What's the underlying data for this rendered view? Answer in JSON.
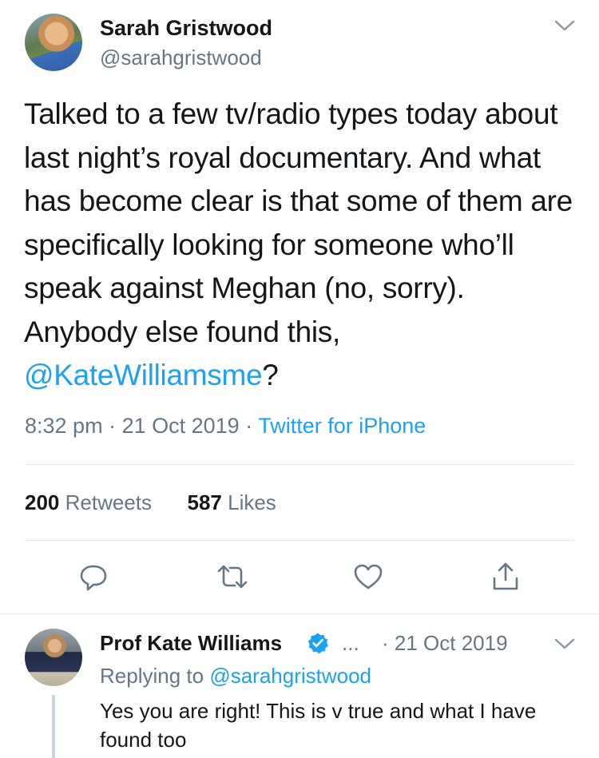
{
  "tweet": {
    "author_name": "Sarah Gristwood",
    "author_handle": "@sarahgristwood",
    "text_before_mention": "Talked to a few tv/radio types today about last night’s royal documentary. And what has become clear is that some of them are specifically looking for someone who’ll speak against Meghan (no, sorry). Anybody else found this, ",
    "mention": "@KateWilliamsme",
    "text_after_mention": "?",
    "time": "8:32 pm",
    "separator": "·",
    "date": "21 Oct 2019",
    "source": "Twitter for iPhone",
    "retweets_count": "200",
    "retweets_label": "Retweets",
    "likes_count": "587",
    "likes_label": "Likes"
  },
  "actions": {
    "icons": [
      "reply-icon",
      "retweet-icon",
      "like-icon",
      "share-icon"
    ]
  },
  "reply": {
    "author_name": "Prof Kate Williams",
    "ellipsis": "...",
    "date": "· 21 Oct 2019",
    "replying_prefix": "Replying to",
    "replying_handle": "@sarahgristwood",
    "text": "Yes you are right! This is v true and what I have found too"
  },
  "colors": {
    "link": "#1da1f2",
    "muted": "#657786",
    "text": "#14171a",
    "divider": "#e1e8ed",
    "verified": "#1da1f2"
  }
}
